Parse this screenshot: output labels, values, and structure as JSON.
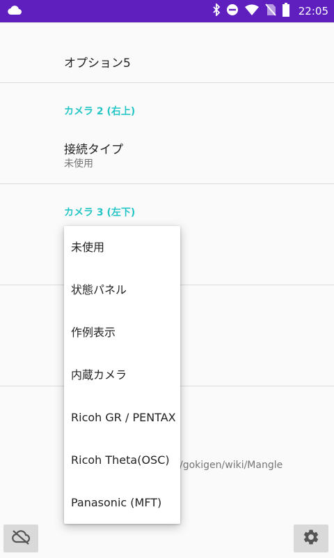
{
  "status_bar": {
    "time": "22:05"
  },
  "settings": {
    "option5_title": "オプション5",
    "camera2": {
      "category": "カメラ 2 (右上)",
      "connection_title": "接続タイプ",
      "connection_value": "未使用"
    },
    "camera3": {
      "category": "カメラ 3 (左下)"
    },
    "url_fragment": "/gokigen/wiki/Mangle"
  },
  "popup": {
    "items": [
      "未使用",
      "状態パネル",
      "作例表示",
      "内蔵カメラ",
      "Ricoh GR / PENTAX",
      "Ricoh Theta(OSC)",
      "Panasonic (MFT)"
    ]
  },
  "icons": {
    "cloud_status": "cloud-icon",
    "bluetooth": "bluetooth-icon",
    "dnd": "do-not-disturb-icon",
    "wifi": "wifi-icon",
    "no_sim": "no-sim-icon",
    "battery": "battery-icon",
    "cloud_off": "cloud-off-icon",
    "settings": "gear-icon"
  },
  "colors": {
    "status_bar": "#5f1fbf",
    "accent": "#26c6c6"
  }
}
